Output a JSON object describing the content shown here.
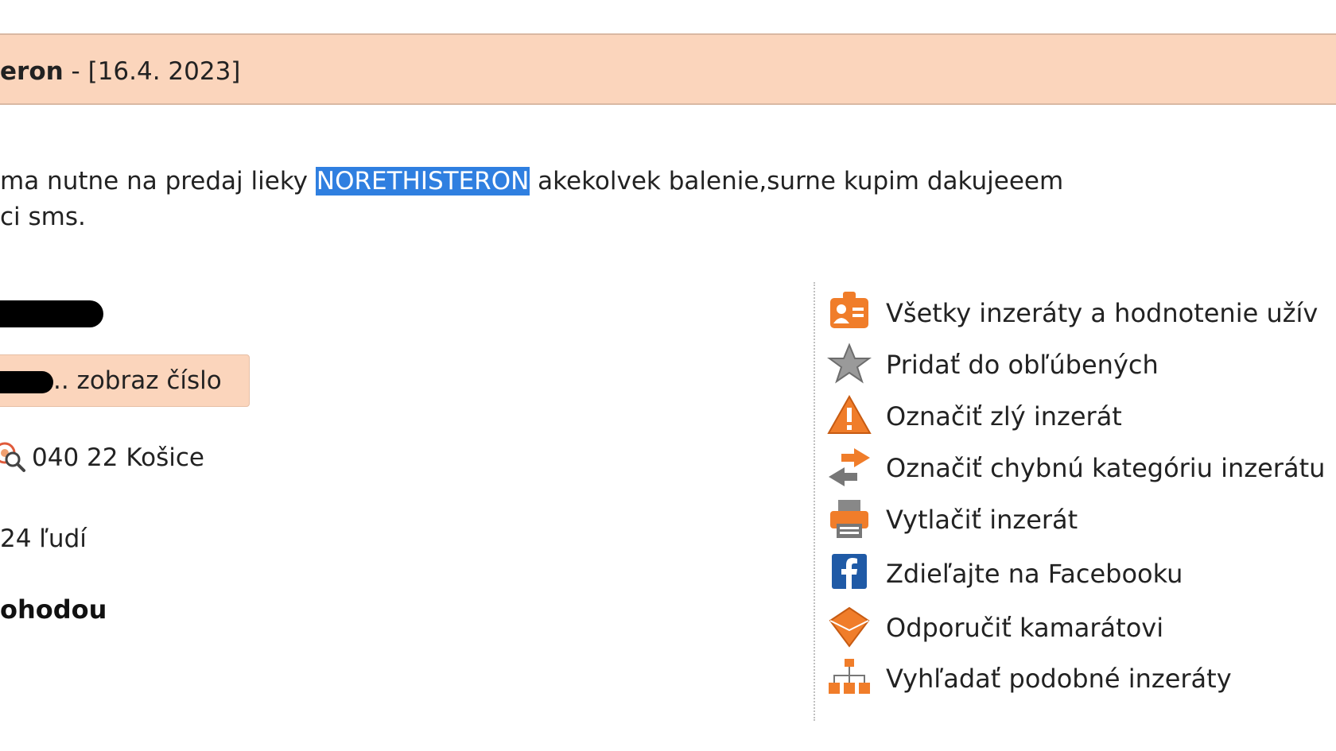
{
  "header": {
    "title_fragment": "eron",
    "separator": " - ",
    "date": "[16.4. 2023]"
  },
  "description": {
    "line1_before": "ma nutne na predaj lieky ",
    "line1_highlight": "NORETHISTERON",
    "line1_after": " akekolvek balenie,surne kupim dakujeeem",
    "line2": "ci sms."
  },
  "contact": {
    "phone_button_label": ".. zobraz číslo",
    "location": "040 22 Košice",
    "viewers": "24 ľudí",
    "price": "ohodou"
  },
  "actions": [
    {
      "icon": "user-card-icon",
      "label": "Všetky inzeráty a hodnotenie užív"
    },
    {
      "icon": "star-icon",
      "label": "Pridať do obľúbených"
    },
    {
      "icon": "warning-icon",
      "label": "Označiť zlý inzerát"
    },
    {
      "icon": "swap-arrows-icon",
      "label": "Označiť chybnú kategóriu inzerátu"
    },
    {
      "icon": "printer-icon",
      "label": "Vytlačiť inzerát"
    },
    {
      "icon": "facebook-icon",
      "label": "Zdieľajte na Facebooku"
    },
    {
      "icon": "envelope-icon",
      "label": "Odporučiť kamarátovi"
    },
    {
      "icon": "sitemap-icon",
      "label": "Vyhľadať podobné inzeráty"
    }
  ],
  "colors": {
    "header_bg": "#fbd5bc",
    "highlight_bg": "#2f7fe0",
    "icon_orange": "#f07d2a",
    "facebook_blue": "#1f5aa6"
  }
}
